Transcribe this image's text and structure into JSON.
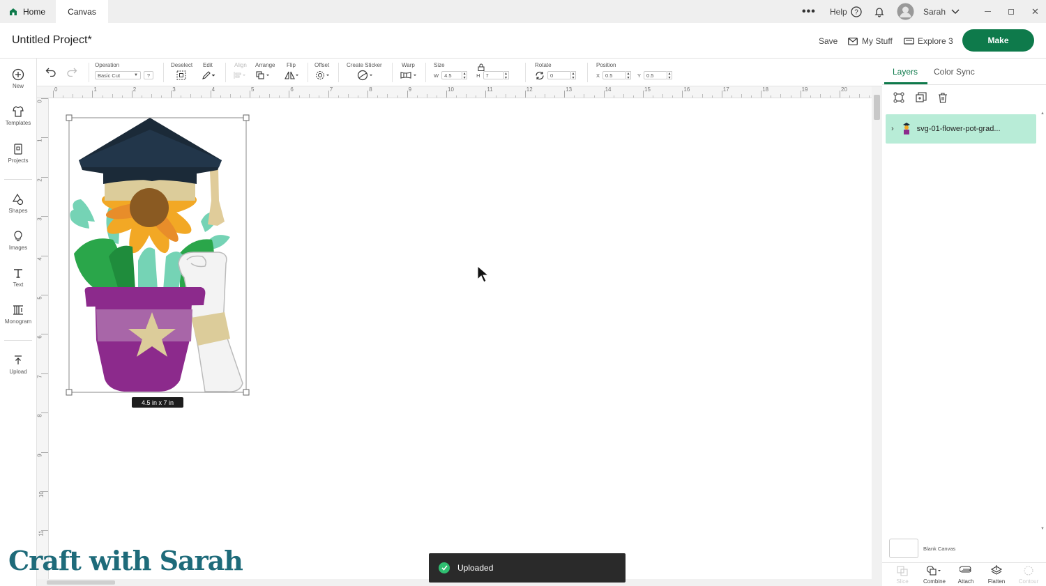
{
  "tabs": {
    "home": "Home",
    "canvas": "Canvas"
  },
  "topbar": {
    "help": "Help",
    "user": "Sarah"
  },
  "header": {
    "title": "Untitled Project*",
    "save": "Save",
    "my_stuff": "My Stuff",
    "machine": "Explore 3",
    "make": "Make"
  },
  "toolbar": {
    "operation_label": "Operation",
    "operation_value": "Basic Cut",
    "deselect": "Deselect",
    "edit": "Edit",
    "align": "Align",
    "arrange": "Arrange",
    "flip": "Flip",
    "offset": "Offset",
    "create_sticker": "Create Sticker",
    "warp": "Warp",
    "size": "Size",
    "w_label": "W",
    "w_value": "4.5",
    "h_label": "H",
    "h_value": "7",
    "rotate": "Rotate",
    "rotate_value": "0",
    "position": "Position",
    "x_label": "X",
    "x_value": "0.5",
    "y_label": "Y",
    "y_value": "0.5"
  },
  "leftnav": [
    {
      "label": "New",
      "icon": "plus-circle-icon"
    },
    {
      "label": "Templates",
      "icon": "shirt-icon"
    },
    {
      "label": "Projects",
      "icon": "projects-icon"
    },
    {
      "label": "Shapes",
      "icon": "shapes-icon"
    },
    {
      "label": "Images",
      "icon": "lightbulb-icon"
    },
    {
      "label": "Text",
      "icon": "text-icon"
    },
    {
      "label": "Monogram",
      "icon": "monogram-icon"
    },
    {
      "label": "Upload",
      "icon": "upload-icon"
    }
  ],
  "ruler": {
    "top": [
      "0",
      "1",
      "2",
      "3",
      "4",
      "5",
      "6",
      "7",
      "8",
      "9",
      "10",
      "11",
      "12",
      "13",
      "14",
      "15",
      "16",
      "17",
      "18",
      "19",
      "20"
    ],
    "left": [
      "0",
      "1",
      "2",
      "3",
      "4",
      "5",
      "6",
      "7",
      "8",
      "9",
      "10",
      "11"
    ]
  },
  "canvas": {
    "size_badge": "4.5  in x 7  in"
  },
  "rightpanel": {
    "tab_layers": "Layers",
    "tab_color_sync": "Color Sync",
    "layer_name": "svg-01-flower-pot-grad...",
    "blank_canvas": "Blank Canvas",
    "tools": [
      "Slice",
      "Combine",
      "Attach",
      "Flatten",
      "Contour"
    ]
  },
  "toast": {
    "message": "Uploaded"
  },
  "watermark": "Craft with Sarah",
  "colors": {
    "brand_green": "#0e7a4b",
    "layer_highlight": "#b8ecd7",
    "pot_purple": "#8c2a8c",
    "cap_navy": "#1b2a38",
    "sunflower": "#f2a825"
  }
}
